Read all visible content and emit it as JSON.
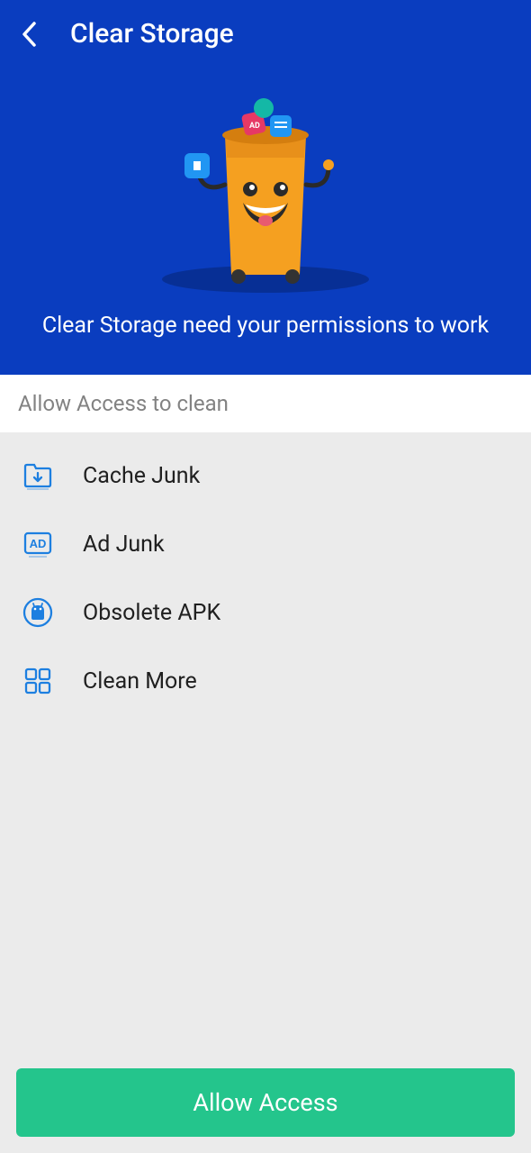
{
  "header": {
    "title": "Clear Storage",
    "permission_text": "Clear Storage need your permissions to work"
  },
  "section": {
    "label": "Allow Access to clean"
  },
  "items": [
    {
      "icon": "folder-download-icon",
      "label": "Cache Junk"
    },
    {
      "icon": "ad-icon",
      "label": "Ad Junk"
    },
    {
      "icon": "android-icon",
      "label": "Obsolete APK"
    },
    {
      "icon": "grid-icon",
      "label": "Clean More"
    }
  ],
  "button": {
    "allow_label": "Allow Access"
  },
  "colors": {
    "primary_blue": "#0a3dbf",
    "accent_green": "#24c58c",
    "icon_blue": "#1d7fe0"
  }
}
